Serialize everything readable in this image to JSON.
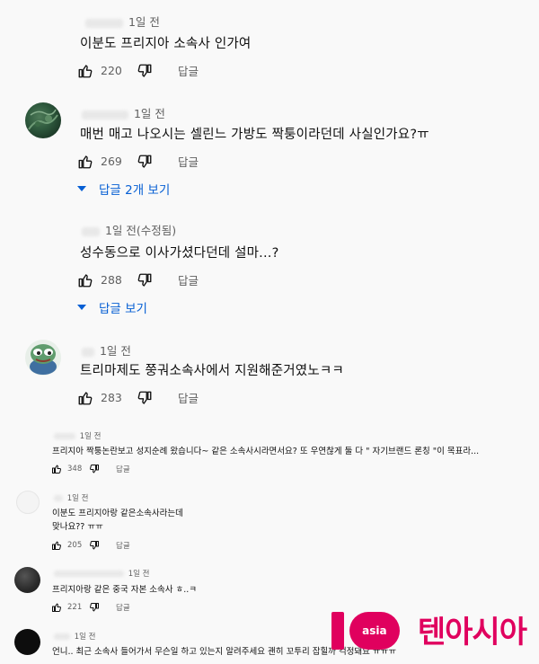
{
  "comments": [
    {
      "time": "1일 전",
      "text": "이분도 프리지아 소속사 인가여",
      "likes": "220",
      "reply": "답글"
    },
    {
      "time": "1일 전",
      "text": "매번 매고 나오시는 셀린느 가방도 짝퉁이라던데 사실인가요?ㅠ",
      "likes": "269",
      "reply": "답글",
      "replies_toggle": "답글 2개 보기"
    },
    {
      "time": "1일 전(수정됨)",
      "text": "성수동으로 이사가셨다던데 설마...?",
      "likes": "288",
      "reply": "답글",
      "replies_toggle": "답글 보기"
    },
    {
      "time": "1일 전",
      "text": "트리마제도 쭝궈소속사에서 지원해준거였노ㅋㅋ",
      "likes": "283",
      "reply": "답글"
    },
    {
      "time": "1일 전",
      "text": "프리지아 짝퉁논란보고 성지순례 왔습니다~ 같은 소속사시라면서요? 또 우연찮게 둘 다 \" 자기브랜드 론칭 \"이 목표라...",
      "likes": "348",
      "reply": "답글"
    },
    {
      "time": "1일 전",
      "text_line1": "이분도 프리지아랑 같은소속사라는데",
      "text_line2": "맞나요?? ㅠㅠ",
      "likes": "205",
      "reply": "답글"
    },
    {
      "time": "1일 전",
      "text": "프리지아랑 같은 중국 자본 소속사 ㅎ..ㅋ",
      "likes": "221",
      "reply": "답글"
    },
    {
      "time": "1일 전",
      "text": "언니.. 최근 소속사 들어가서 무슨일 하고 있는지 알려주세요 괜히 꼬투리 잡힐까 걱정돼요 ㅠㅠㅠ"
    }
  ],
  "watermark": {
    "asia": "asia",
    "brand": "텐아시아"
  },
  "icons": [
    "thumbs-up-icon",
    "thumbs-down-icon",
    "caret-down-icon"
  ],
  "colors": {
    "link": "#065fd4",
    "watermark": "#e0005e"
  }
}
